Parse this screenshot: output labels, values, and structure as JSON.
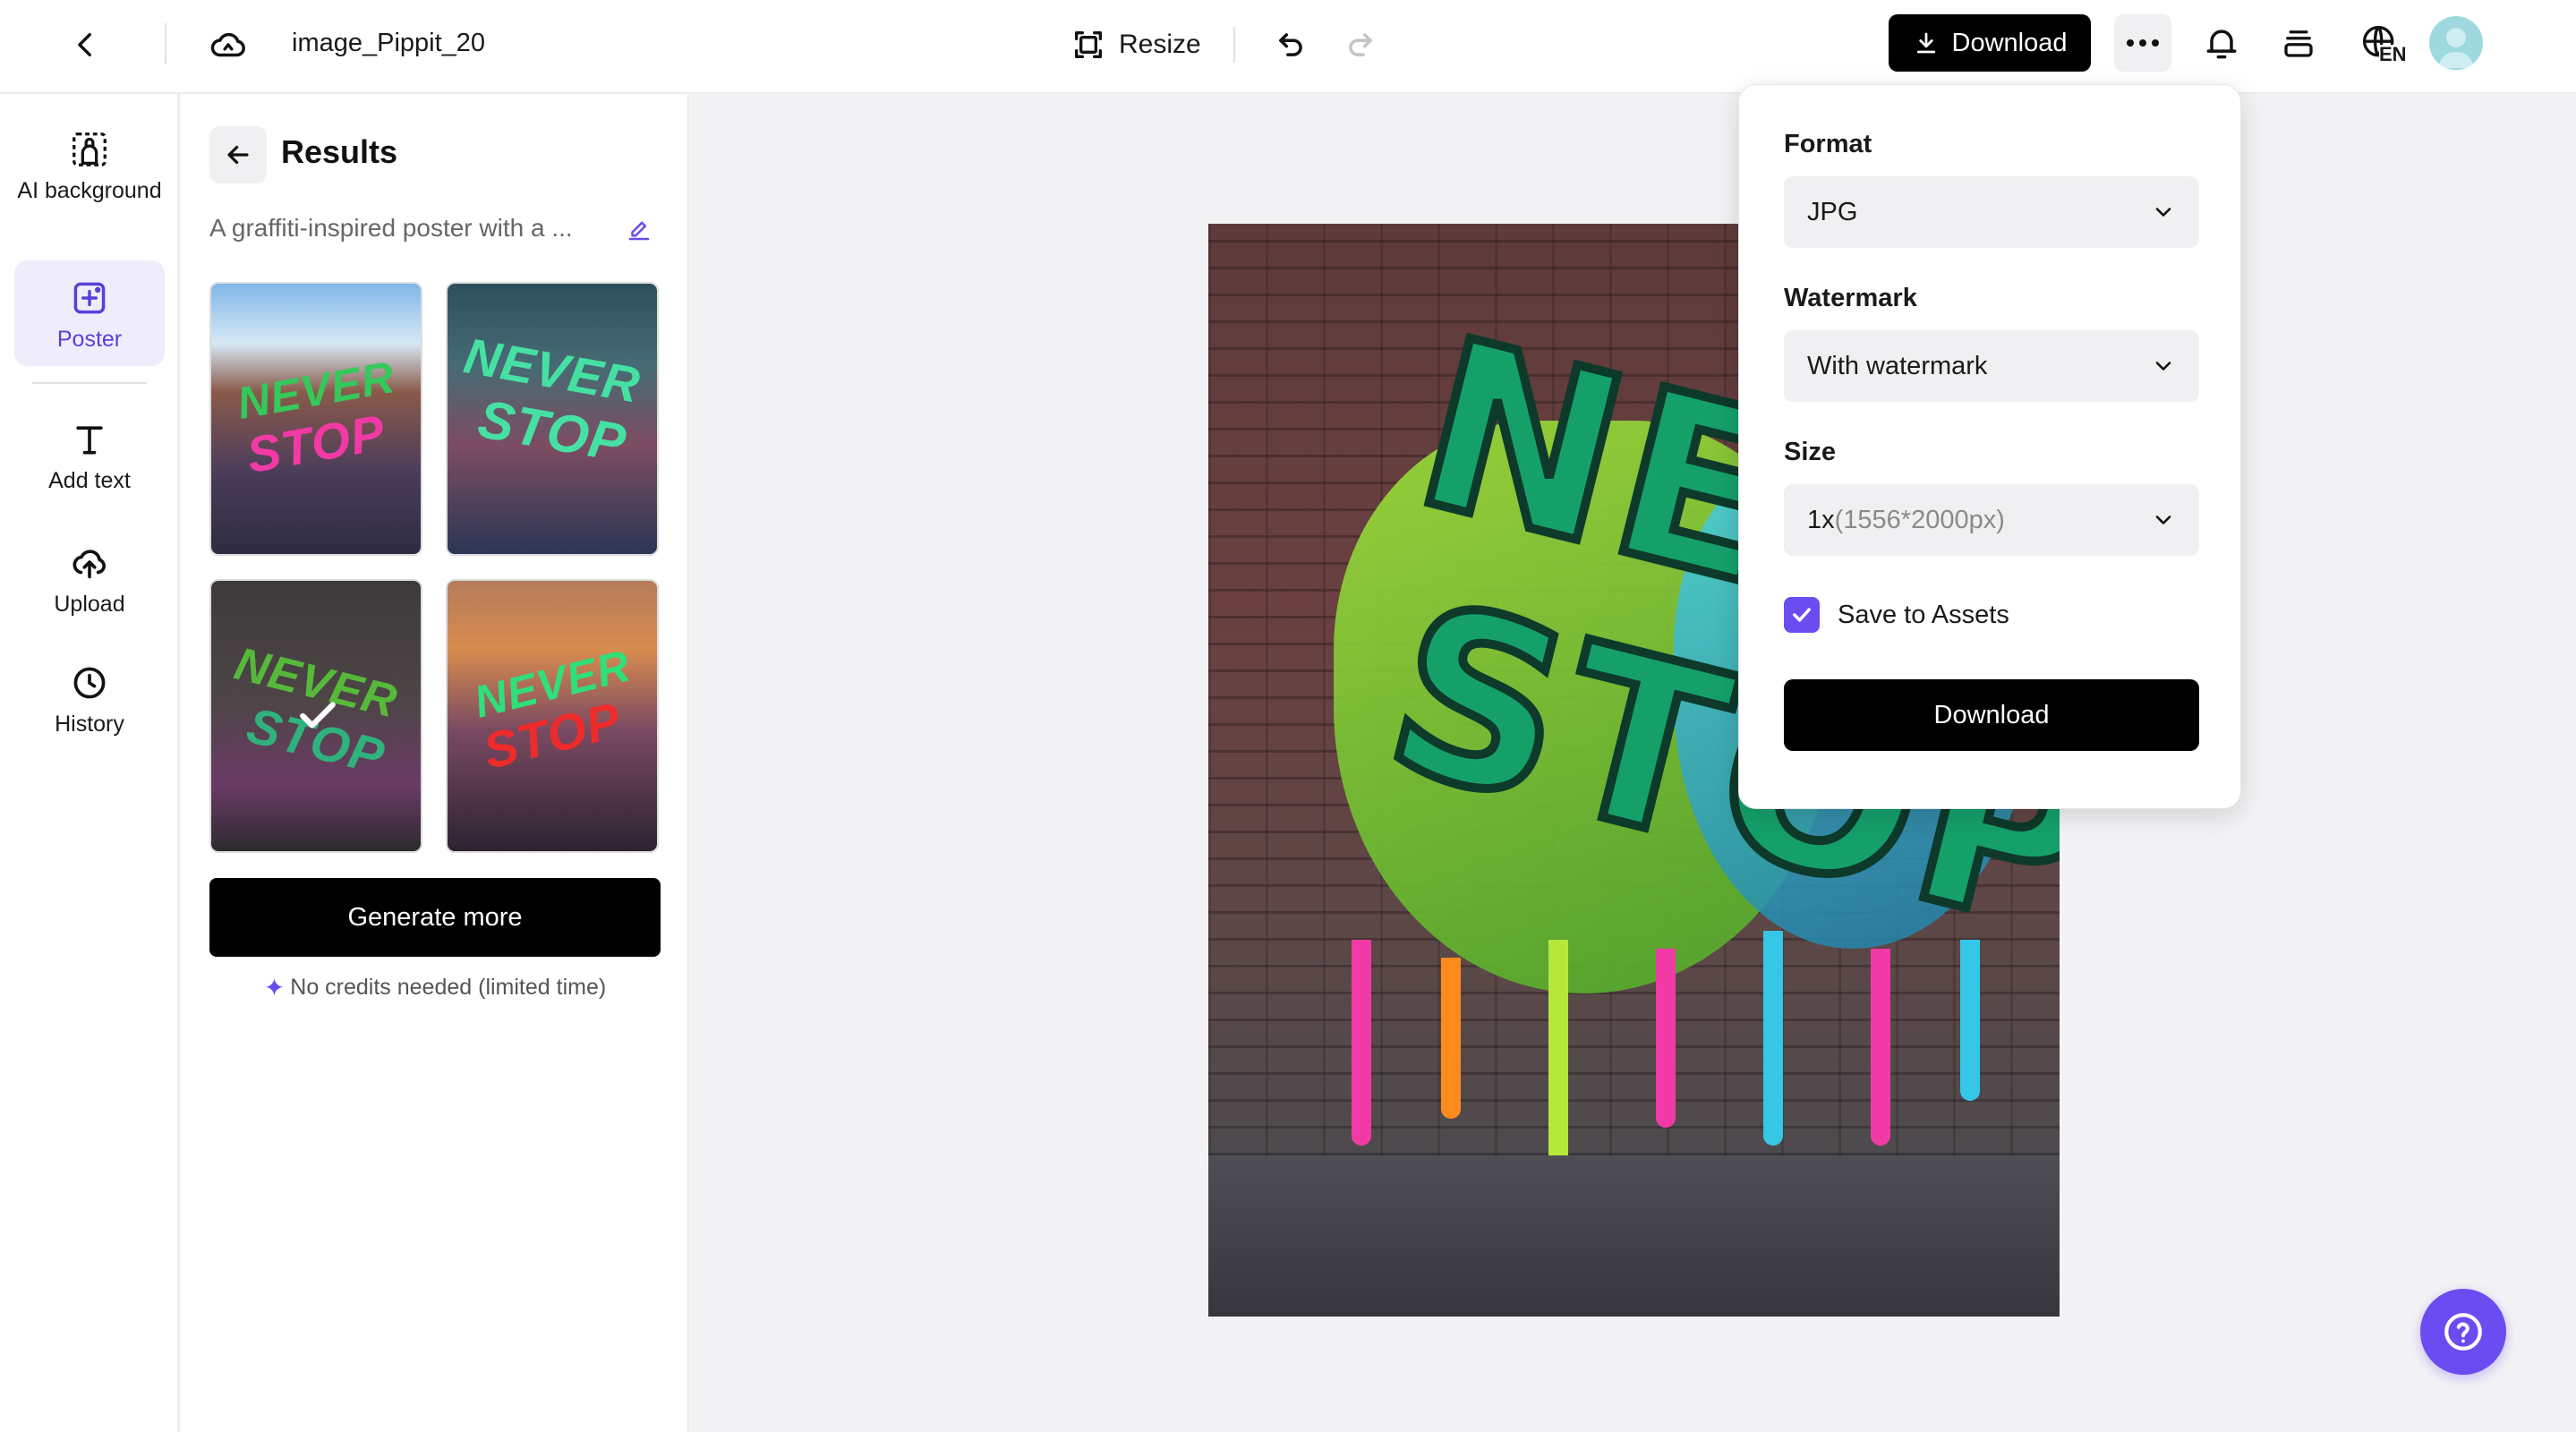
{
  "header": {
    "file_name": "image_Pippit_20",
    "resize_label": "Resize",
    "download_label": "Download",
    "language_code": "EN"
  },
  "rail": {
    "items": [
      {
        "label": "AI background",
        "icon": "ai-background-icon"
      },
      {
        "label": "Poster",
        "icon": "poster-icon",
        "active": true
      },
      {
        "label": "Add text",
        "icon": "text-icon"
      },
      {
        "label": "Upload",
        "icon": "upload-icon"
      },
      {
        "label": "History",
        "icon": "history-icon"
      }
    ]
  },
  "results": {
    "title": "Results",
    "prompt": "A graffiti-inspired poster with a ...",
    "thumbnails": [
      {
        "line1": "NEVER",
        "line2": "STOP",
        "selected": false
      },
      {
        "line1": "NEVER",
        "line2": "STOP",
        "selected": false
      },
      {
        "line1": "NEVER",
        "line2": "STOP",
        "selected": true
      },
      {
        "line1": "NEVER",
        "line2": "STOP",
        "selected": false
      }
    ],
    "generate_label": "Generate more",
    "credits_note": "No credits needed (limited time)"
  },
  "canvas": {
    "line1": "NEVER",
    "line2": "STOP"
  },
  "download_popover": {
    "format_label": "Format",
    "format_value": "JPG",
    "watermark_label": "Watermark",
    "watermark_value": "With watermark",
    "size_label": "Size",
    "size_value": "1x",
    "size_detail": "(1556*2000px)",
    "save_to_assets_label": "Save to Assets",
    "save_to_assets_checked": true,
    "download_label": "Download"
  },
  "colors": {
    "accent": "#6b4cf0",
    "primary_button": "#000000",
    "poster_active_bg": "#efedfb"
  }
}
